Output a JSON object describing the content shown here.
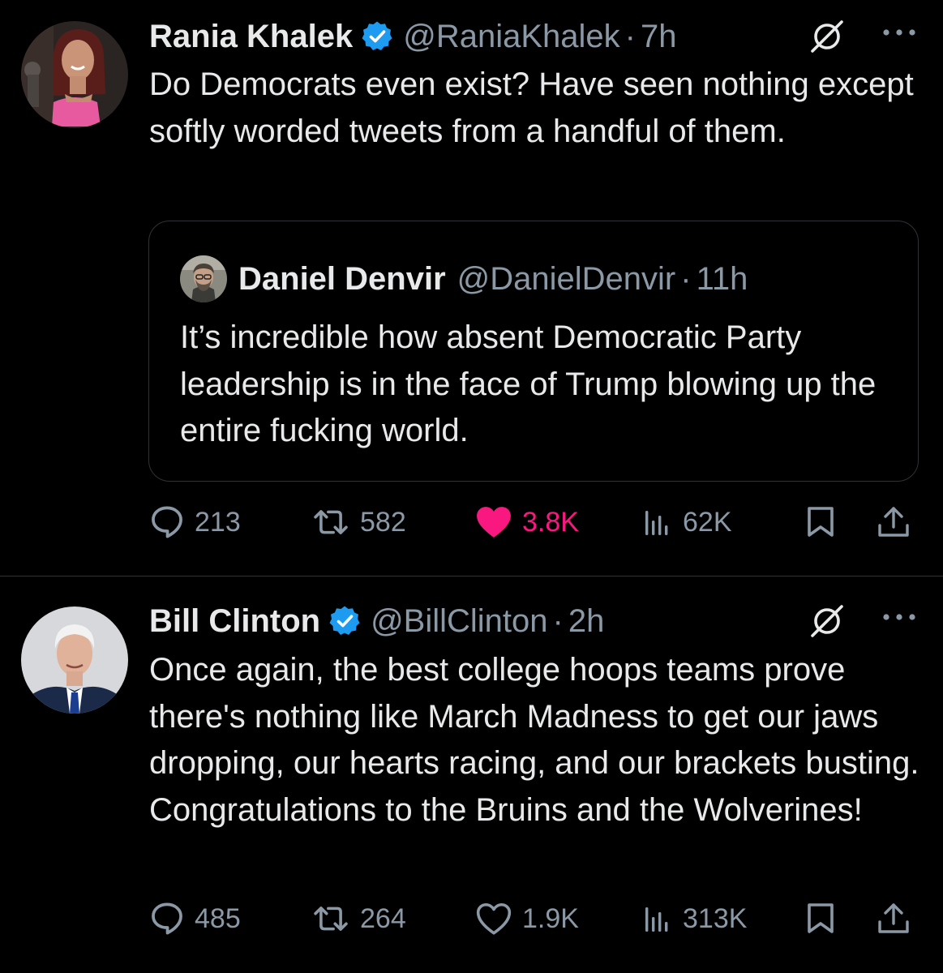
{
  "colors": {
    "background": "#000000",
    "text": "#e7e9ea",
    "secondary_text": "#8b98a5",
    "verified": "#1d9bf0",
    "like_active": "#f91880",
    "divider": "#2f3336"
  },
  "tweets": [
    {
      "author": {
        "name": "Rania Khalek",
        "handle": "@RaniaKhalek",
        "verified": true,
        "avatar": "profile-photo"
      },
      "separator": "·",
      "time": "7h",
      "text": "Do Democrats even exist? Have seen nothing except softly worded tweets from a handful of them.",
      "quoted_tweet": {
        "author": {
          "name": "Daniel Denvir",
          "handle": "@DanielDenvir",
          "avatar": "profile-photo"
        },
        "separator": "·",
        "time": "11h",
        "text": "It’s incredible how absent Democratic Party leadership is in the face of Trump blowing up the entire fucking world."
      },
      "stats": {
        "replies": "213",
        "reposts": "582",
        "likes": "3.8K",
        "liked": true,
        "views": "62K"
      },
      "icons": [
        "grok-icon",
        "more-icon",
        "reply-icon",
        "repost-icon",
        "like-icon",
        "views-icon",
        "bookmark-icon",
        "share-icon"
      ]
    },
    {
      "author": {
        "name": "Bill Clinton",
        "handle": "@BillClinton",
        "verified": true,
        "avatar": "profile-photo"
      },
      "separator": "·",
      "time": "2h",
      "text": "Once again, the best college hoops teams prove there's nothing like March Madness to get our jaws dropping, our hearts racing, and our brackets busting. Congratulations to the Bruins and the Wolverines!",
      "stats": {
        "replies": "485",
        "reposts": "264",
        "likes": "1.9K",
        "liked": false,
        "views": "313K"
      },
      "icons": [
        "grok-icon",
        "more-icon",
        "reply-icon",
        "repost-icon",
        "like-icon",
        "views-icon",
        "bookmark-icon",
        "share-icon"
      ]
    }
  ]
}
